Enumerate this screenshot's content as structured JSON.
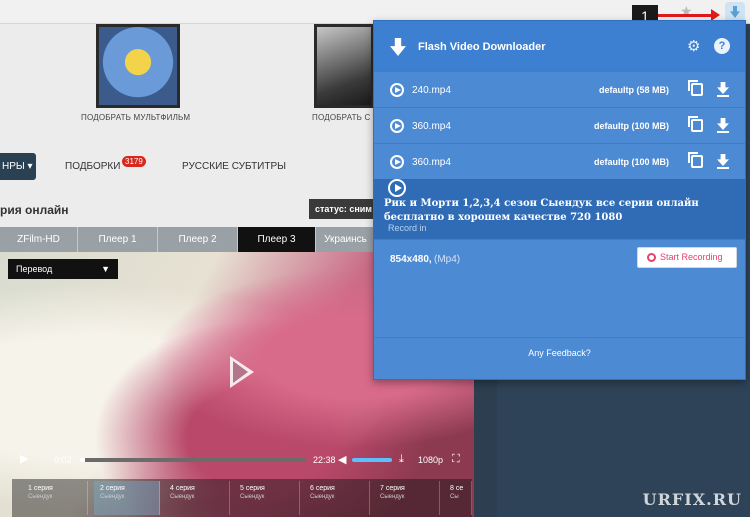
{
  "site": {
    "posters": [
      {
        "caption": "ПОДОБРАТЬ МУЛЬТФИЛЬМ"
      },
      {
        "caption": "ПОДОБРАТЬ С"
      }
    ],
    "nav": {
      "genre_label": "НРЫ ▾",
      "collections_label": "ПОДБОРКИ",
      "collections_count": "3179",
      "subtitles_label": "РУССКИЕ СУБТИТРЫ"
    },
    "online_title": "рия онлайн",
    "status_label": "статус: сним",
    "player_tabs": [
      "ZFilm-HD",
      "Плеер 1",
      "Плеер 2",
      "Плеер 3",
      "Украинсь"
    ],
    "active_player_tab": "Плеер 3",
    "video": {
      "translation_select": "Перевод",
      "current_time": "0:02",
      "duration": "22:38",
      "quality": "1080p",
      "progress": 0.02
    },
    "episodes": [
      {
        "title": "1 серия",
        "sub": "Сыендук"
      },
      {
        "title": "2 серия",
        "sub": "Сыендук"
      },
      {
        "title": "4 серия",
        "sub": "Сыендук"
      },
      {
        "title": "5 серия",
        "sub": "Сыендук"
      },
      {
        "title": "6 серия",
        "sub": "Сыендук"
      },
      {
        "title": "7 серия",
        "sub": "Сыендук"
      },
      {
        "title": "8 се",
        "sub": "Сы"
      }
    ]
  },
  "annotation": {
    "step_number": "1",
    "watermark": "URFIX.RU"
  },
  "popup": {
    "title": "Flash Video Downloader",
    "files": [
      {
        "name": "240.mp4",
        "info": "defaultp (58 MB)"
      },
      {
        "name": "360.mp4",
        "info": "defaultp (100 MB)"
      },
      {
        "name": "360.mp4",
        "info": "defaultp (100 MB)"
      }
    ],
    "record": {
      "title": "Рик и Морти 1,2,3,4 сезон Сыендук все серии онлайн бесплатно в хорошем качестве 720 1080",
      "record_in_label": "Record in",
      "resolution": "854x480,",
      "format": "(Mp4)",
      "button_label": "Start Recording"
    },
    "feedback_label": "Any Feedback?"
  },
  "colors": {
    "popup_bg": "#4d8ad4",
    "popup_header": "#3d7fd0",
    "record_accent": "#e0446a",
    "badge_red": "#d9271d"
  }
}
